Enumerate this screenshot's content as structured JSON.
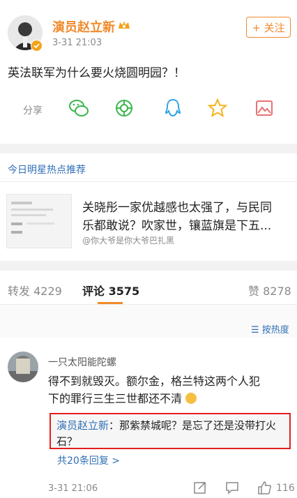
{
  "post": {
    "author_name": "演员赵立新",
    "timestamp": "3-31 21:03",
    "follow_label": "+ 关注",
    "body": "英法联军为什么要火烧圆明园？！",
    "share_label": "分享",
    "share_icons": [
      "wechat-icon",
      "moments-icon",
      "qq-icon",
      "qzone-star-icon",
      "image-share-icon"
    ]
  },
  "hot": {
    "section_title": "今日明星热点推荐",
    "headline_line1": "关晓彤一家优越感也太强了，与民同",
    "headline_line2": "乐都敢说？吹家世，镶蓝旗是下五...",
    "source": "@你大爷是你大爷巴扎黑"
  },
  "tabs": {
    "repost": "转发",
    "repost_count": "4229",
    "comment": "评论",
    "comment_count": "3575",
    "like": "赞",
    "like_count": "8278"
  },
  "sort": {
    "label": "按热度"
  },
  "comment": {
    "user": "一只太阳能陀螺",
    "text_line1": "得不到就毁灭。额尔金，格兰特这两个人犯",
    "text_line2": "下的罪行三生三世都还不清",
    "reply_author": "演员赵立新",
    "reply_text_line1": "：那紫禁城呢？是忘了还是没带打火",
    "reply_text_line2": "石？",
    "reply_count": "共20条回复 >",
    "timestamp": "3-31 21:06",
    "likes": "116"
  },
  "colors": {
    "accent": "#f08a2b",
    "link": "#2f6fb6",
    "highlight_border": "#e41e1e",
    "tab_underline": "#f08a2b"
  }
}
